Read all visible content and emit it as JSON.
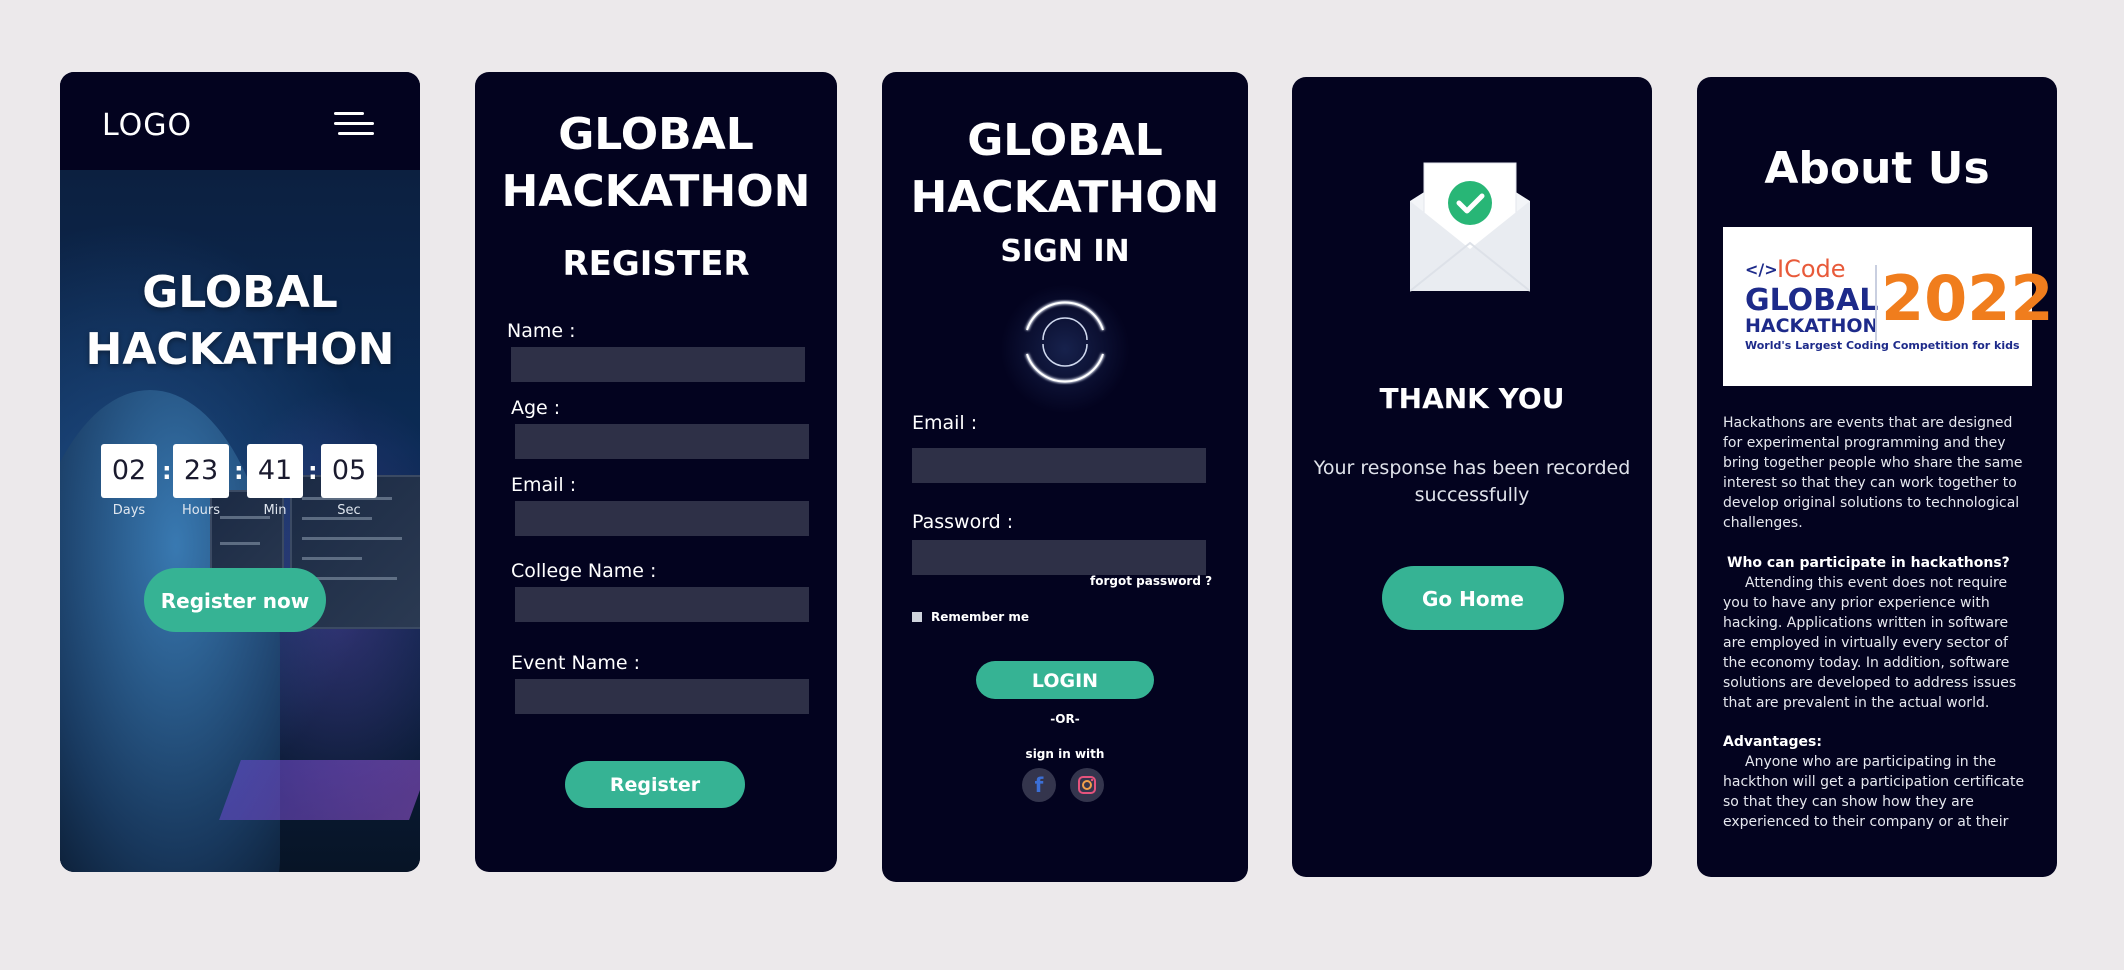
{
  "colors": {
    "page_bg": "#ece9eb",
    "card_bg": "#03031f",
    "accent_green": "#36b394",
    "field_bg": "#2e3047"
  },
  "home": {
    "logo": "LOGO",
    "title_line1": "GLOBAL",
    "title_line2": "HACKATHON",
    "countdown": [
      {
        "value": "02",
        "label": "Days"
      },
      {
        "value": "23",
        "label": "Hours"
      },
      {
        "value": "41",
        "label": "Min"
      },
      {
        "value": "05",
        "label": "Sec"
      }
    ],
    "cta": "Register now",
    "menu_icon": "hamburger-menu-icon"
  },
  "register": {
    "title_line1": "GLOBAL",
    "title_line2": "HACKATHON",
    "heading": "REGISTER",
    "fields": [
      {
        "label": "Name :"
      },
      {
        "label": "Age :"
      },
      {
        "label": "Email :"
      },
      {
        "label": "College Name :"
      },
      {
        "label": "Event Name :"
      }
    ],
    "submit": "Register"
  },
  "signin": {
    "title_line1": "GLOBAL",
    "title_line2": "HACKATHON",
    "heading": "SIGN IN",
    "email_label": "Email :",
    "password_label": "Password :",
    "forgot": "forgot password ?",
    "remember": "Remember me",
    "login": "LOGIN",
    "or": "-OR-",
    "sign_in_with": "sign in with",
    "social": [
      {
        "icon": "facebook-icon",
        "glyph": "f"
      },
      {
        "icon": "instagram-icon"
      }
    ]
  },
  "thanks": {
    "heading": "THANK YOU",
    "message": "Your response has been recorded successfully",
    "button": "Go Home",
    "icon": "envelope-check-icon"
  },
  "about": {
    "heading": "About Us",
    "banner": {
      "brand": "ICode",
      "line1": "GLOBAL",
      "line2": "HACKATHON",
      "year": "2022",
      "tagline": "World's Largest Coding Competition for kids",
      "code_glyph": "</>"
    },
    "intro": "Hackathons are events that are designed for experimental programming and they bring together people who share the same interest so that they can work together to develop original solutions to technological challenges.",
    "who_heading": "Who can participate in hackathons?",
    "who_text": "Attending this event does not require you to have any prior experience with hacking. Applications written in software are employed in virtually every sector of the economy today. In addition, software solutions are developed to address issues that are prevalent in the actual world.",
    "adv_heading": "Advantages:",
    "adv_text": "Anyone who are participating in the hackthon will get a participation certificate so that they can show how they are experienced to their company or at their"
  }
}
